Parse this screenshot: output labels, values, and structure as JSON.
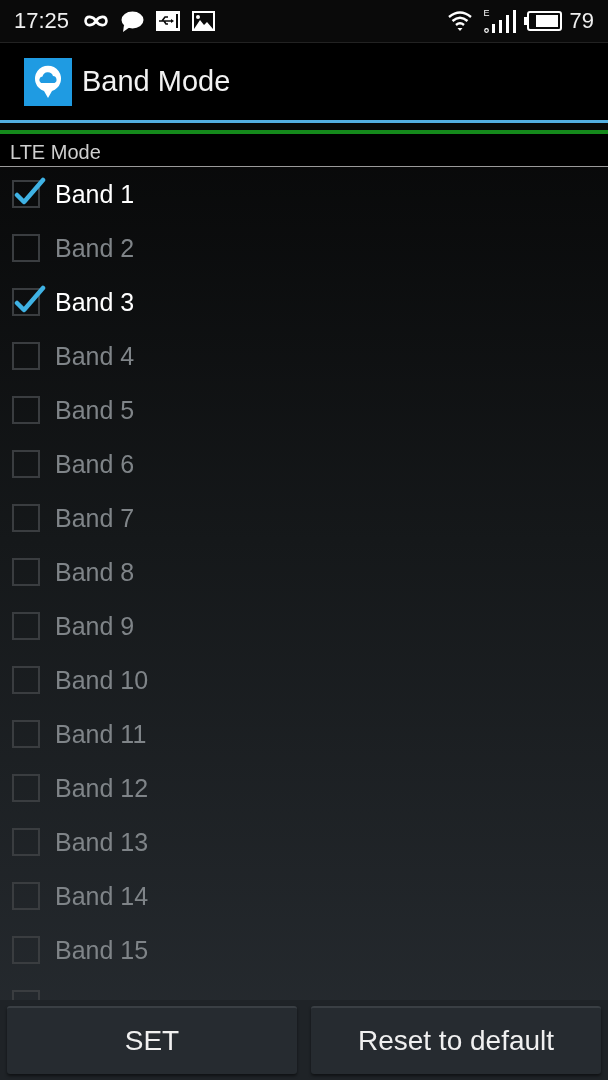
{
  "status_bar": {
    "time": "17:25",
    "network_type": "E",
    "battery": "79"
  },
  "app_bar": {
    "title": "Band Mode"
  },
  "section": {
    "title": "LTE Mode"
  },
  "bands": [
    {
      "label": "Band 1",
      "checked": true
    },
    {
      "label": "Band 2",
      "checked": false
    },
    {
      "label": "Band 3",
      "checked": true
    },
    {
      "label": "Band 4",
      "checked": false
    },
    {
      "label": "Band 5",
      "checked": false
    },
    {
      "label": "Band 6",
      "checked": false
    },
    {
      "label": "Band 7",
      "checked": false
    },
    {
      "label": "Band 8",
      "checked": false
    },
    {
      "label": "Band 9",
      "checked": false
    },
    {
      "label": "Band 10",
      "checked": false
    },
    {
      "label": "Band 11",
      "checked": false
    },
    {
      "label": "Band 12",
      "checked": false
    },
    {
      "label": "Band 13",
      "checked": false
    },
    {
      "label": "Band 14",
      "checked": false
    },
    {
      "label": "Band 15",
      "checked": false
    },
    {
      "checked": false
    }
  ],
  "buttons": [
    {
      "label": "SET"
    },
    {
      "label": "Reset to default"
    }
  ]
}
